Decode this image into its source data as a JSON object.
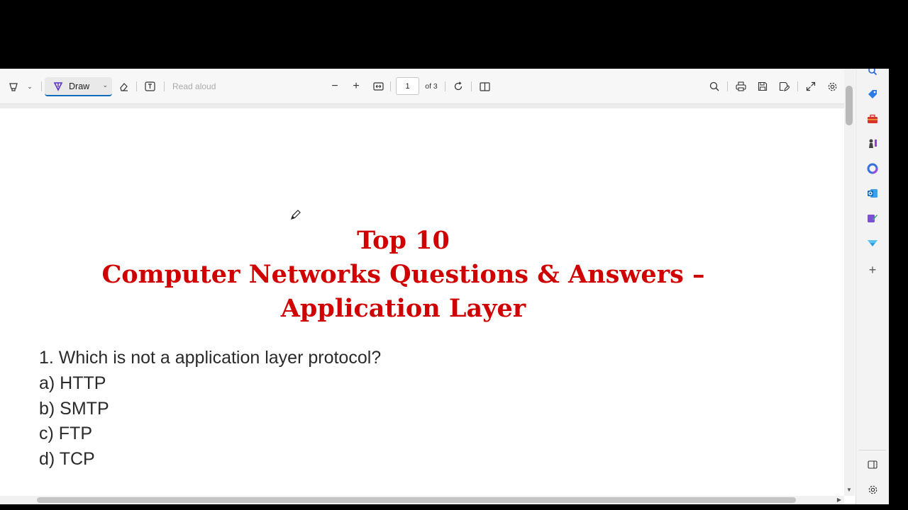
{
  "toolbar": {
    "draw_label": "Draw",
    "read_aloud_label": "Read aloud",
    "zoom_out": "−",
    "zoom_in": "+",
    "page_current": "1",
    "page_total": "of 3"
  },
  "document": {
    "title_line1": "Top 10",
    "title_line2": "Computer Networks Questions & Answers –",
    "title_line3": "Application Layer",
    "question": "1. Which is not a application layer protocol?",
    "options": [
      "a) HTTP",
      "b) SMTP",
      "c) FTP",
      "d) TCP"
    ]
  },
  "colors": {
    "title_red": "#d00000",
    "accent": "#0f6cbd"
  },
  "side_panel_icons": [
    "search-icon",
    "tag-icon",
    "toolbox-icon",
    "chess-icon",
    "copilot-icon",
    "outlook-icon",
    "designer-icon",
    "drop-icon",
    "add-icon",
    "sidebar-toggle-icon",
    "settings-icon"
  ]
}
